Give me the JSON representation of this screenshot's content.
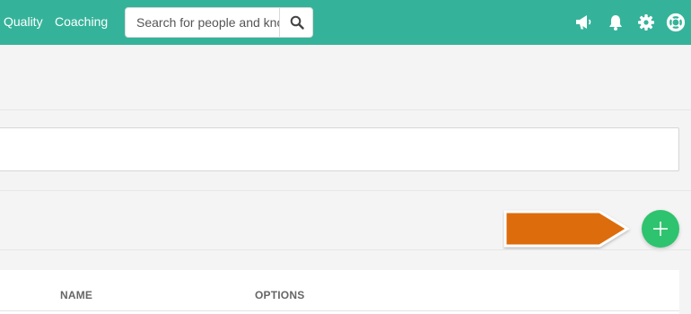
{
  "nav": {
    "links": [
      "Quality",
      "Coaching"
    ]
  },
  "search": {
    "placeholder": "Search for people and knowledge"
  },
  "icons": {
    "search": "search-icon",
    "announcements": "megaphone-icon",
    "notifications": "bell-icon",
    "settings": "gear-icon",
    "help": "lifebuoy-icon",
    "add": "plus-icon"
  },
  "table": {
    "columns": [
      "NAME",
      "OPTIONS"
    ]
  },
  "colors": {
    "topbar": "#35b39a",
    "add_button": "#2ec36e",
    "callout": "#dd6c0f"
  }
}
